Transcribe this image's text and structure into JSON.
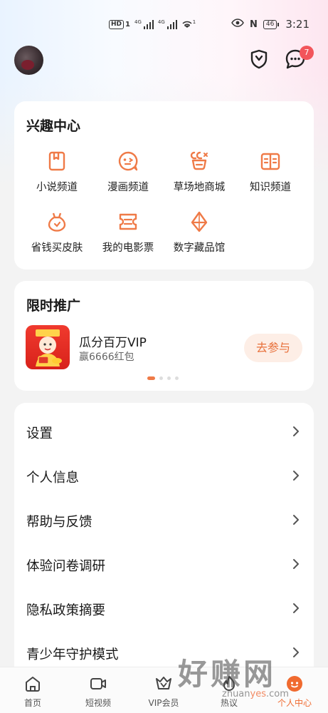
{
  "status_bar": {
    "hd_label": "HD",
    "sim1": "1",
    "net1": "4G",
    "net2": "4G",
    "hotspot_sup": "1",
    "nfc": "N",
    "battery": "46",
    "time": "3:21"
  },
  "header": {
    "message_badge": "7"
  },
  "interest": {
    "title": "兴趣中心",
    "items": [
      {
        "label": "小说频道",
        "icon": "book-icon"
      },
      {
        "label": "漫画频道",
        "icon": "comic-face-icon"
      },
      {
        "label": "草场地商城",
        "icon": "mall-icon"
      },
      {
        "label": "知识频道",
        "icon": "knowledge-icon"
      },
      {
        "label": "省钱买皮肤",
        "icon": "money-bag-icon"
      },
      {
        "label": "我的电影票",
        "icon": "ticket-icon"
      },
      {
        "label": "数字藏品馆",
        "icon": "diamond-icon"
      }
    ]
  },
  "promo": {
    "title": "限时推广",
    "item_title": "瓜分百万VIP",
    "item_sub": "赢6666红包",
    "button": "去参与",
    "page_count": 4,
    "active_page": 1
  },
  "settings": {
    "items": [
      "设置",
      "个人信息",
      "帮助与反馈",
      "体验问卷调研",
      "隐私政策摘要",
      "青少年守护模式"
    ]
  },
  "bottom_nav": {
    "items": [
      {
        "label": "首页",
        "icon": "home-icon"
      },
      {
        "label": "短视频",
        "icon": "video-icon"
      },
      {
        "label": "VIP会员",
        "icon": "vip-crown-icon"
      },
      {
        "label": "热议",
        "icon": "hot-topic-icon"
      },
      {
        "label": "个人中心",
        "icon": "profile-icon"
      }
    ],
    "active_index": 4
  },
  "watermark": {
    "main": "好赚网",
    "site_pre": "zhuan",
    "site_mid": "yes",
    "site_post": ".com"
  },
  "colors": {
    "accent": "#EF7A47",
    "badge": "#F2555B",
    "promo_button_bg": "#FDEEE6"
  }
}
